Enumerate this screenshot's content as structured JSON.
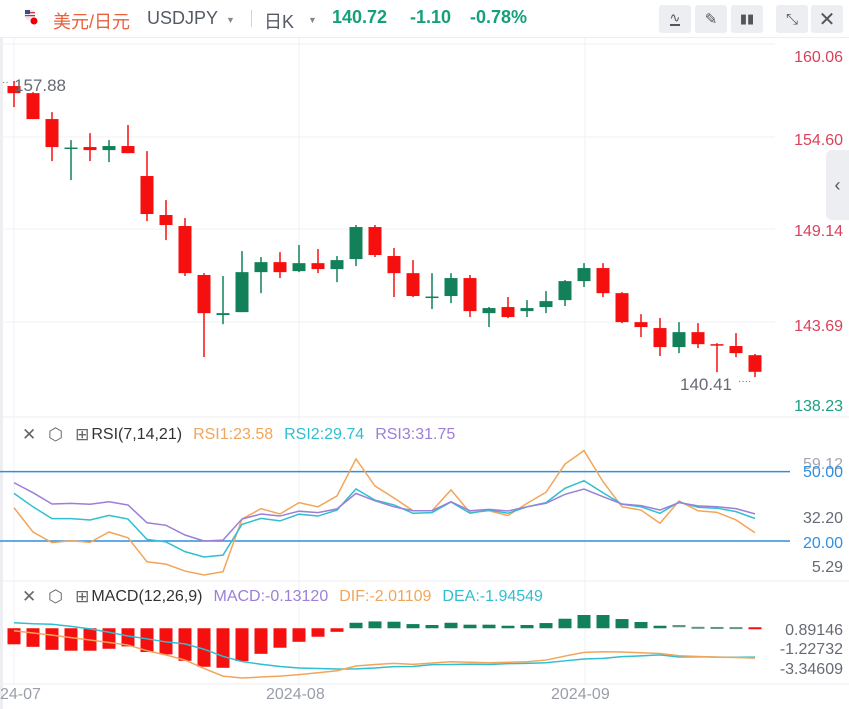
{
  "header": {
    "symbol_cn": "美元/日元",
    "symbol_en": "USDJPY",
    "period": "日K",
    "price": "140.72",
    "change": "-1.10",
    "change_pct": "-0.78%",
    "buttons": [
      "indicator-icon",
      "draw-icon",
      "candle-type-icon",
      "collapse-icon",
      "close-icon"
    ],
    "quote_color": "#14a07c"
  },
  "colors": {
    "down": "#f50f0f",
    "up": "#128058",
    "rsi1": "#f2a55a",
    "rsi2": "#2fbfd0",
    "rsi3": "#9b7fd8",
    "dif": "#f2a55a",
    "dea": "#2fbfd0",
    "axis_red": "#d9425a",
    "axis_green": "#1a9f7f",
    "ref_line": "#2f8fe0"
  },
  "price_axis": {
    "labels": [
      "160.06",
      "154.60",
      "149.14",
      "143.69",
      "138.23"
    ],
    "max": 160.06,
    "min": 138.23
  },
  "annotations": {
    "high": "157.88",
    "low": "140.41"
  },
  "rsi": {
    "title": "RSI(7,14,21)",
    "rsi1_label": "RSI1:23.58",
    "rsi2_label": "RSI2:29.74",
    "rsi3_label": "RSI3:31.75",
    "axis_labels": [
      "59.12",
      "50.00",
      "32.20",
      "20.00",
      "5.29"
    ],
    "max": 59.12,
    "min": 5.29,
    "ref_lines": [
      50,
      20
    ]
  },
  "macd": {
    "title": "MACD(12,26,9)",
    "macd_label": "MACD:-0.13120",
    "dif_label": "DIF:-2.01109",
    "dea_label": "DEA:-1.94549",
    "axis_labels": [
      "0.89146",
      "-1.22732",
      "-3.34609"
    ],
    "max": 0.89146,
    "min": -3.34609
  },
  "date_axis": {
    "labels": [
      "24-07",
      "2024-08",
      "2024-09"
    ]
  },
  "chart_data": {
    "type": "candlestick",
    "ohlc": [
      [
        157.58,
        157.88,
        156.34,
        157.16
      ],
      [
        157.16,
        157.22,
        155.63,
        155.63
      ],
      [
        155.63,
        156.04,
        153.15,
        153.98
      ],
      [
        153.89,
        154.39,
        152.03,
        153.95
      ],
      [
        153.98,
        154.8,
        153.15,
        153.8
      ],
      [
        153.8,
        154.39,
        153.09,
        154.04
      ],
      [
        154.04,
        155.28,
        153.62,
        153.62
      ],
      [
        152.27,
        153.74,
        149.61,
        150.03
      ],
      [
        149.97,
        150.85,
        148.49,
        149.38
      ],
      [
        149.32,
        149.79,
        146.37,
        146.54
      ],
      [
        146.43,
        146.54,
        141.59,
        144.18
      ],
      [
        144.07,
        146.37,
        143.53,
        144.18
      ],
      [
        144.24,
        147.84,
        144.24,
        146.6
      ],
      [
        146.6,
        147.49,
        145.36,
        147.19
      ],
      [
        147.19,
        147.78,
        146.25,
        146.6
      ],
      [
        146.66,
        148.2,
        146.6,
        147.13
      ],
      [
        147.13,
        147.96,
        146.54,
        146.78
      ],
      [
        146.78,
        147.55,
        146.01,
        147.31
      ],
      [
        147.37,
        149.38,
        146.96,
        149.26
      ],
      [
        149.26,
        149.38,
        147.49,
        147.61
      ],
      [
        147.55,
        148.02,
        145.13,
        146.54
      ],
      [
        146.54,
        147.31,
        145.13,
        145.19
      ],
      [
        145.1,
        146.54,
        144.42,
        145.16
      ],
      [
        145.19,
        146.54,
        144.77,
        146.25
      ],
      [
        146.25,
        146.43,
        143.95,
        144.3
      ],
      [
        144.18,
        144.54,
        143.36,
        144.48
      ],
      [
        144.54,
        145.13,
        143.89,
        143.95
      ],
      [
        144.3,
        144.95,
        143.95,
        144.48
      ],
      [
        144.54,
        145.48,
        144.18,
        144.89
      ],
      [
        144.95,
        146.13,
        144.6,
        146.07
      ],
      [
        146.07,
        147.13,
        145.72,
        146.84
      ],
      [
        146.84,
        147.13,
        145.13,
        145.36
      ],
      [
        145.36,
        145.42,
        143.59,
        143.65
      ],
      [
        143.65,
        144.12,
        142.77,
        143.36
      ],
      [
        143.3,
        143.89,
        141.65,
        142.18
      ],
      [
        142.18,
        143.65,
        141.82,
        143.06
      ],
      [
        143.06,
        143.59,
        142.12,
        142.35
      ],
      [
        142.35,
        142.41,
        140.7,
        142.3
      ],
      [
        142.24,
        143.0,
        141.59,
        141.82
      ],
      [
        141.7,
        141.77,
        140.41,
        140.72
      ]
    ],
    "rsi1": [
      34.4,
      23.9,
      19.3,
      20.1,
      19.4,
      23.9,
      21.4,
      11.0,
      10.0,
      7.0,
      5.29,
      6.7,
      29.5,
      34.0,
      31.7,
      36.6,
      34.8,
      39.5,
      55.5,
      43.8,
      38.6,
      33.1,
      33.1,
      42.1,
      32.3,
      33.1,
      31.0,
      36.3,
      41.1,
      53.3,
      59.12,
      45.7,
      34.8,
      33.4,
      27.7,
      37.3,
      33.1,
      32.4,
      29.1,
      23.58
    ],
    "rsi2": [
      40.6,
      34.8,
      29.7,
      29.7,
      29.1,
      31.1,
      29.5,
      20.7,
      19.6,
      15.4,
      13.1,
      13.9,
      27.2,
      29.8,
      28.7,
      31.6,
      30.8,
      33.4,
      42.5,
      37.7,
      35.6,
      32.0,
      32.3,
      36.9,
      32.0,
      33.4,
      32.0,
      34.8,
      36.6,
      42.8,
      46.1,
      40.9,
      35.9,
      34.8,
      32.0,
      36.9,
      34.6,
      34.2,
      32.7,
      29.74
    ],
    "rsi3": [
      45.2,
      40.9,
      36.0,
      36.3,
      35.9,
      37.0,
      35.6,
      27.9,
      26.8,
      22.6,
      20.0,
      20.4,
      29.5,
      31.7,
      30.8,
      32.9,
      32.3,
      33.9,
      40.6,
      37.4,
      34.8,
      33.1,
      33.1,
      37.0,
      33.1,
      33.7,
      33.0,
      34.8,
      36.3,
      40.2,
      42.5,
      39.2,
      36.0,
      35.3,
      33.4,
      36.6,
      35.2,
      34.8,
      34.0,
      31.75
    ],
    "macd_hist": [
      -1.08,
      -1.25,
      -1.45,
      -1.51,
      -1.51,
      -1.38,
      -1.22,
      -1.6,
      -1.76,
      -2.19,
      -2.59,
      -2.66,
      -2.21,
      -1.72,
      -1.31,
      -0.91,
      -0.57,
      -0.24,
      0.37,
      0.46,
      0.44,
      0.28,
      0.22,
      0.37,
      0.24,
      0.24,
      0.17,
      0.22,
      0.35,
      0.64,
      0.89146,
      0.89,
      0.62,
      0.42,
      0.17,
      0.15,
      0.03,
      0.02,
      0.01,
      -0.1312
    ],
    "dif": [
      -0.17,
      -0.32,
      -0.46,
      -0.63,
      -0.79,
      -0.96,
      -1.13,
      -1.51,
      -1.8,
      -2.14,
      -2.7,
      -3.22,
      -3.34609,
      -3.28,
      -3.22,
      -3.12,
      -2.99,
      -2.86,
      -2.54,
      -2.44,
      -2.36,
      -2.43,
      -2.34,
      -2.25,
      -2.29,
      -2.32,
      -2.29,
      -2.25,
      -2.14,
      -1.87,
      -1.62,
      -1.58,
      -1.6,
      -1.65,
      -1.7,
      -1.85,
      -1.9,
      -1.94,
      -1.97,
      -2.01109
    ],
    "dea": [
      0.37,
      0.3,
      0.27,
      0.13,
      -0.04,
      -0.27,
      -0.52,
      -0.71,
      -0.92,
      -1.05,
      -1.41,
      -1.89,
      -2.24,
      -2.42,
      -2.57,
      -2.67,
      -2.71,
      -2.74,
      -2.73,
      -2.67,
      -2.58,
      -2.57,
      -2.45,
      -2.44,
      -2.41,
      -2.44,
      -2.38,
      -2.36,
      -2.32,
      -2.19,
      -2.07,
      -2.03,
      -1.91,
      -1.86,
      -1.79,
      -1.93,
      -1.92,
      -1.94,
      -1.95,
      -1.94549
    ]
  }
}
